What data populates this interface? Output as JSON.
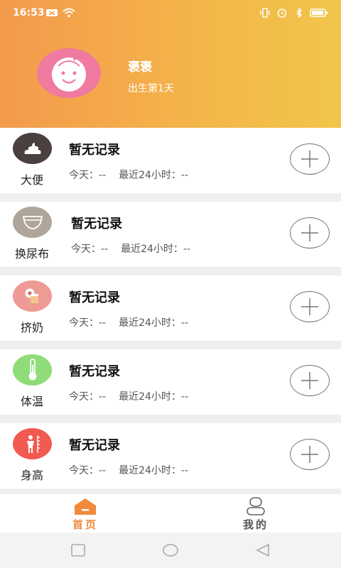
{
  "status_bar": {
    "time": "16:53",
    "left_icons": [
      "notification-icon",
      "wifi-icon"
    ],
    "right_icons": [
      "vibrate-icon",
      "alarm-icon",
      "bluetooth-icon",
      "battery-icon"
    ]
  },
  "profile": {
    "name": "褒褒",
    "age_text": "出生第1天",
    "avatar_color": "#f07aa0"
  },
  "records": [
    {
      "label": "大便",
      "title": "暂无记录",
      "today": "今天：--",
      "recent": "最近24小时：--",
      "icon": "poop-icon",
      "icon_bg": "#4a4040"
    },
    {
      "label": "换尿布",
      "title": "暂无记录",
      "today": "今天：--",
      "recent": "最近24小时：--",
      "icon": "diaper-icon",
      "icon_bg": "#b0a59a"
    },
    {
      "label": "挤奶",
      "title": "暂无记录",
      "today": "今天：--",
      "recent": "最近24小时：--",
      "icon": "breast-pump-icon",
      "icon_bg": "#ee9a95"
    },
    {
      "label": "体温",
      "title": "暂无记录",
      "today": "今天：--",
      "recent": "最近24小时：--",
      "icon": "thermometer-icon",
      "icon_bg": "#8fdc78"
    },
    {
      "label": "身高",
      "title": "暂无记录",
      "today": "今天：--",
      "recent": "最近24小时：--",
      "icon": "height-icon",
      "icon_bg": "#f05a50"
    }
  ],
  "tabs": [
    {
      "label": "首页",
      "icon": "home-icon",
      "color": "#f08a3c",
      "active": true
    },
    {
      "label": "我的",
      "icon": "profile-icon",
      "color": "#555555",
      "active": false
    }
  ],
  "system_nav": [
    "recent-apps-icon",
    "home-nav-icon",
    "back-icon"
  ],
  "colors": {
    "header_start": "#f39a4c",
    "header_end": "#f1c54a",
    "accent": "#f08a3c"
  }
}
